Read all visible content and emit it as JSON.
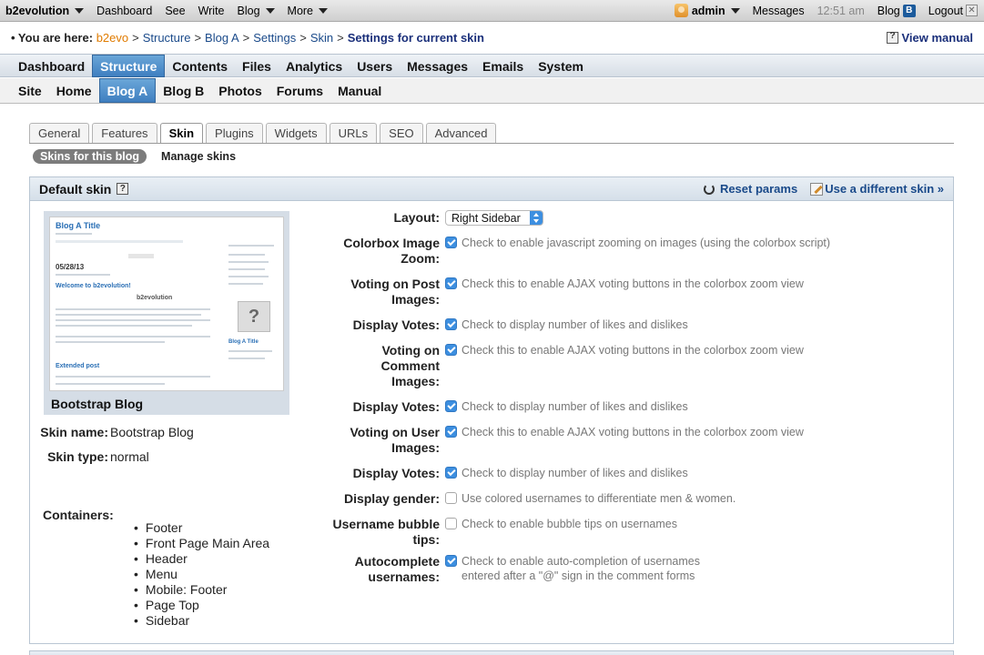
{
  "evobar": {
    "brand": "b2evolution",
    "items": [
      "Dashboard",
      "See",
      "Write",
      "Blog",
      "More"
    ],
    "user": "admin",
    "messages": "Messages",
    "time": "12:51 am",
    "blog": "Blog",
    "blog_icon": "B",
    "logout": "Logout"
  },
  "breadcrumb": {
    "lead": "• You are here:",
    "home": "b2evo",
    "items": [
      "Structure",
      "Blog A",
      "Settings",
      "Skin"
    ],
    "current": "Settings for current skin",
    "manual": "View manual"
  },
  "menu1": [
    "Dashboard",
    "Structure",
    "Contents",
    "Files",
    "Analytics",
    "Users",
    "Messages",
    "Emails",
    "System"
  ],
  "menu2": [
    "Site",
    "Home",
    "Blog A",
    "Blog B",
    "Photos",
    "Forums",
    "Manual"
  ],
  "tabs": [
    "General",
    "Features",
    "Skin",
    "Plugins",
    "Widgets",
    "URLs",
    "SEO",
    "Advanced"
  ],
  "subtabs": [
    "Skins for this blog",
    "Manage skins"
  ],
  "panel": {
    "title": "Default skin",
    "reset": "Reset params",
    "use_different": "Use a different skin »"
  },
  "preview": {
    "blog_title": "Blog A Title",
    "date": "05/28/13",
    "post_title": "Welcome to b2evolution!",
    "logo": "b2evolution",
    "side_title": "Blog A Title",
    "ext_post": "Extended post",
    "name": "Bootstrap Blog"
  },
  "meta": {
    "name_label": "Skin name:",
    "name_value": "Bootstrap Blog",
    "type_label": "Skin type:",
    "type_value": "normal",
    "containers_label": "Containers:",
    "containers": [
      "Footer",
      "Front Page Main Area",
      "Header",
      "Menu",
      "Mobile: Footer",
      "Page Top",
      "Sidebar"
    ]
  },
  "settings": [
    {
      "label": "Layout:",
      "type": "select",
      "value": "Right Sidebar"
    },
    {
      "label": "Colorbox Image Zoom:",
      "checked": true,
      "note": "Check to enable javascript zooming on images (using the colorbox script)"
    },
    {
      "label": "Voting on Post Images:",
      "checked": true,
      "note": "Check this to enable AJAX voting buttons in the colorbox zoom view"
    },
    {
      "label": "Display Votes:",
      "checked": true,
      "note": "Check to display number of likes and dislikes"
    },
    {
      "label": "Voting on Comment Images:",
      "checked": true,
      "note": "Check this to enable AJAX voting buttons in the colorbox zoom view"
    },
    {
      "label": "Display Votes:",
      "checked": true,
      "note": "Check to display number of likes and dislikes"
    },
    {
      "label": "Voting on User Images:",
      "checked": true,
      "note": "Check this to enable AJAX voting buttons in the colorbox zoom view"
    },
    {
      "label": "Display Votes:",
      "checked": true,
      "note": "Check to display number of likes and dislikes"
    },
    {
      "label": "Display gender:",
      "checked": false,
      "note": "Use colored usernames to differentiate men & women."
    },
    {
      "label": "Username bubble tips:",
      "checked": false,
      "note": "Check to enable bubble tips on usernames"
    },
    {
      "label": "Autocomplete usernames:",
      "checked": true,
      "note": "Check to enable auto-completion of usernames entered after a \"@\" sign in the comment forms"
    }
  ]
}
